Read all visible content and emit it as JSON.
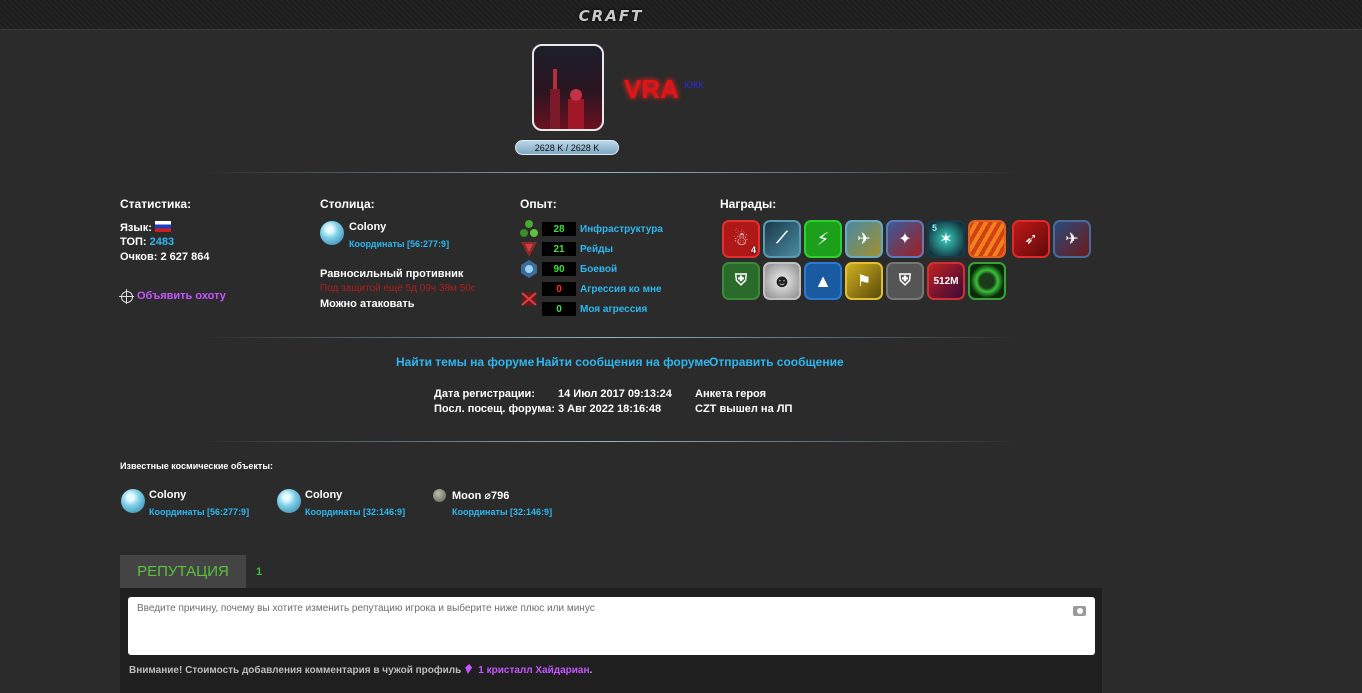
{
  "header": {
    "logo_text": "CRAFT"
  },
  "profile": {
    "nickname": "VRA",
    "nick_tag": "ЮКК",
    "hp_text": "2628 K / 2628 K"
  },
  "stats": {
    "title": "Статистика:",
    "language_label": "Язык:",
    "top_label": "ТОП:",
    "top_value": "2483",
    "points_text": "Очков: 2 627 864",
    "hunt_link": "Объявить охоту"
  },
  "capital": {
    "title": "Столица:",
    "planet_name": "Colony",
    "coords": "Координаты [56:277:9]",
    "opponent_label": "Равносильный противник",
    "protection_text": "Под защитой ещё 5д 09ч 38м 50с",
    "attack_text": "Можно атаковать"
  },
  "experience": {
    "title": "Опыт:",
    "rows": [
      {
        "value": "28",
        "label": "Инфраструктура",
        "color": "#3ee03e"
      },
      {
        "value": "21",
        "label": "Рейды",
        "color": "#3ee03e"
      },
      {
        "value": "90",
        "label": "Боевой",
        "color": "#3ee03e"
      },
      {
        "value": "0",
        "label": "Агрессия ко мне",
        "color": "#ff2a2a"
      },
      {
        "value": "0",
        "label": "Моя агрессия",
        "color": "#3ee03e"
      }
    ]
  },
  "awards": {
    "title": "Награды:",
    "row1_badge_count": "4",
    "row1_badge_num": "5",
    "row2_badge_512": "512M"
  },
  "nav": {
    "find_topics": "Найти темы на форуме",
    "find_messages": "Найти сообщения на форуме",
    "send_message": "Отправить сообщение"
  },
  "dates": {
    "reg_label": "Дата регистрации:",
    "reg_value": "14 Июл 2017 09:13:24",
    "visit_label": "Посл. посещ. форума:",
    "visit_value": "3 Авг 2022 18:16:48",
    "hero_link": "Анкета героя",
    "status_text": "CZT вышел на ЛП"
  },
  "objects": {
    "title": "Известные космические объекты:",
    "items": [
      {
        "name": "Colony",
        "coords": "Координаты [56:277:9]"
      },
      {
        "name": "Colony",
        "coords": "Координаты [32:146:9]"
      },
      {
        "name": "Moon ⌀796",
        "coords": "Координаты [32:146:9]"
      }
    ]
  },
  "reputation": {
    "tab_label": "РЕПУТАЦИЯ",
    "count": "1",
    "placeholder": "Введите причину, почему вы хотите изменить репутацию игрока и выберите ниже плюс или минус",
    "warning_text": "Внимание! Стоимость добавления комментария в чужой профиль",
    "cost_text": "1 кристалл Хайдариан",
    "cost_suffix": "."
  }
}
